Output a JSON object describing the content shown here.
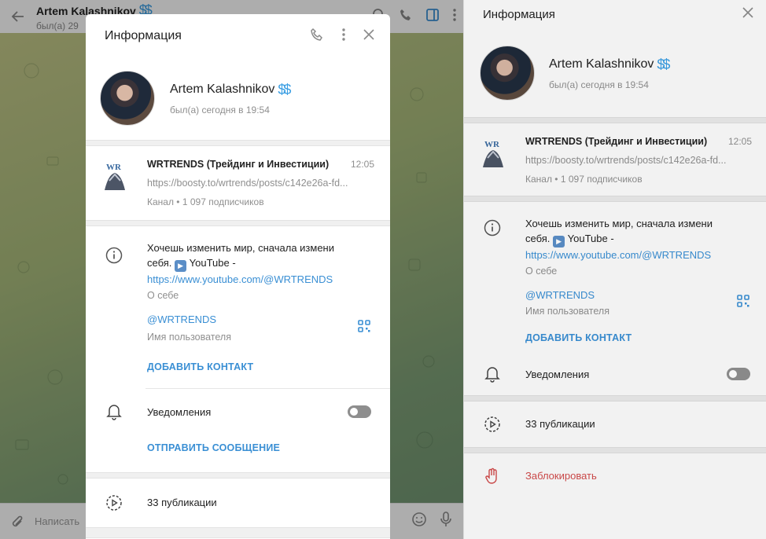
{
  "chat_header": {
    "name": "Artem Kalashnikov",
    "name_badge": "$$",
    "status": "был(а) 29"
  },
  "chat_input": {
    "placeholder": "Написать"
  },
  "modal": {
    "title": "Информация",
    "profile": {
      "name": "Artem Kalashnikov",
      "badge": "$$",
      "status": "был(а) сегодня в 19:54"
    },
    "channel": {
      "name": "WRTRENDS (Трейдинг и Инвестиции)",
      "time": "12:05",
      "link": "https://boosty.to/wrtrends/posts/c142e26a-fd...",
      "subs": "Канал • 1 097 подписчиков"
    },
    "bio": {
      "line1": "Хочешь изменить мир, сначала измени",
      "line2_prefix": "себя.",
      "line2_emoji": "▶",
      "line2_suffix": "YouTube -",
      "link": "https://www.youtube.com/@WRTRENDS",
      "label": "О себе"
    },
    "username": {
      "value": "@WRTRENDS",
      "label": "Имя пользователя"
    },
    "add_contact": "ДОБАВИТЬ КОНТАКТ",
    "notifications": "Уведомления",
    "send_message": "ОТПРАВИТЬ СООБЩЕНИЕ",
    "publications": "33 публикации"
  },
  "panel": {
    "title": "Информация",
    "profile": {
      "name": "Artem Kalashnikov",
      "badge": "$$",
      "status": "был(а) сегодня в 19:54"
    },
    "channel": {
      "name": "WRTRENDS (Трейдинг и Инвестиции)",
      "time": "12:05",
      "link": "https://boosty.to/wrtrends/posts/c142e26a-fd...",
      "subs": "Канал • 1 097 подписчиков"
    },
    "bio": {
      "line1": "Хочешь изменить мир, сначала измени",
      "line2_prefix": "себя.",
      "line2_emoji": "▶",
      "line2_suffix": "YouTube -",
      "link": "https://www.youtube.com/@WRTRENDS",
      "label": "О себе"
    },
    "username": {
      "value": "@WRTRENDS",
      "label": "Имя пользователя"
    },
    "add_contact": "ДОБАВИТЬ КОНТАКТ",
    "notifications": "Уведомления",
    "publications": "33 публикации",
    "block": "Заблокировать"
  },
  "colors": {
    "accent": "#3a8fd4",
    "danger": "#d14b4b",
    "toggle_off": "#8e8e8e"
  },
  "icons": {
    "back": "arrow-left-icon",
    "search": "search-icon",
    "call": "phone-icon",
    "sidebar": "sidebar-toggle-icon",
    "more": "more-vertical-icon",
    "close": "close-icon",
    "info": "info-icon",
    "qr": "qr-code-icon",
    "bell": "bell-icon",
    "stories": "stories-play-icon",
    "block": "hand-block-icon",
    "attach": "paperclip-icon",
    "emoji": "emoji-icon",
    "mic": "microphone-icon"
  },
  "notifications_enabled": false
}
